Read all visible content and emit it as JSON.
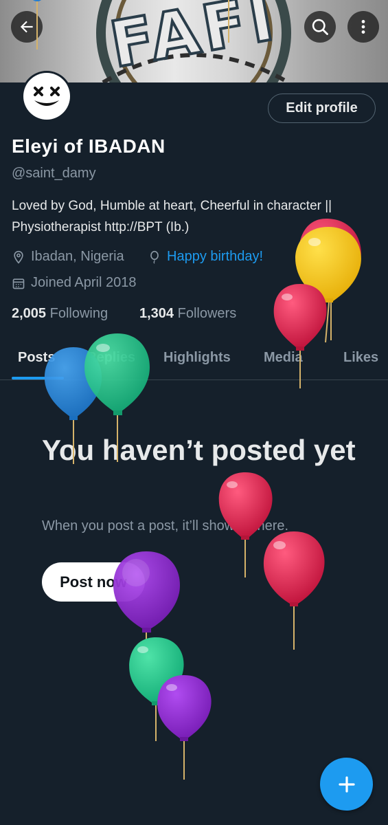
{
  "header": {
    "back_icon": "arrow-left-icon",
    "search_icon": "search-icon",
    "more_icon": "more-vertical-icon",
    "banner_text": "FAFI"
  },
  "profile": {
    "edit_button": "Edit profile",
    "display_name": "Eleyi of IBADAN",
    "handle": "@saint_damy",
    "bio": "Loved by God, Humble at heart, Cheerful in character || Physiotherapist http://BPT (Ib.)",
    "location": "Ibadan, Nigeria",
    "birthday": "Happy birthday!",
    "joined": "Joined April 2018",
    "following_count": "2,005",
    "following_label": "Following",
    "followers_count": "1,304",
    "followers_label": "Followers"
  },
  "tabs": [
    {
      "label": "Posts",
      "active": true
    },
    {
      "label": "Replies",
      "active": false
    },
    {
      "label": "Highlights",
      "active": false
    },
    {
      "label": "Media",
      "active": false
    },
    {
      "label": "Likes",
      "active": false
    }
  ],
  "empty_state": {
    "title": "You haven’t posted yet",
    "subtitle": "When you post a post, it’ll show up here.",
    "button": "Post now"
  },
  "fab": {
    "icon": "plus-icon"
  },
  "colors": {
    "background": "#15202b",
    "accent": "#1d9bf0",
    "secondary_text": "#8b98a5",
    "balloon_red": "#d9224f",
    "balloon_yellow": "#f5c21b",
    "balloon_green": "#20c98a",
    "balloon_purple": "#8e28cc",
    "balloon_blue": "#2b8de0"
  }
}
